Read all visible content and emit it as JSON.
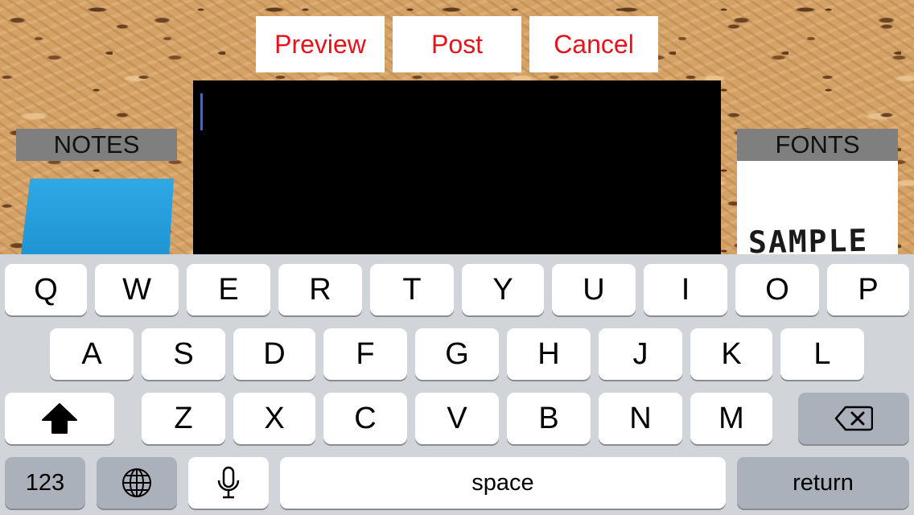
{
  "toolbar": {
    "preview_label": "Preview",
    "post_label": "Post",
    "cancel_label": "Cancel",
    "accent_color": "#e8121a"
  },
  "notes_panel": {
    "label": "NOTES",
    "note_color": "#2fa8e4"
  },
  "fonts_panel": {
    "label": "FONTS",
    "sample_text": "SAMPLE"
  },
  "editor": {
    "value": ""
  },
  "keyboard": {
    "row1": [
      "Q",
      "W",
      "E",
      "R",
      "T",
      "Y",
      "U",
      "I",
      "O",
      "P"
    ],
    "row2": [
      "A",
      "S",
      "D",
      "F",
      "G",
      "H",
      "J",
      "K",
      "L"
    ],
    "row3": [
      "Z",
      "X",
      "C",
      "V",
      "B",
      "N",
      "M"
    ],
    "numbers_label": "123",
    "space_label": "space",
    "return_label": "return",
    "shift_icon": "shift-icon",
    "delete_icon": "delete-icon",
    "globe_icon": "globe-icon",
    "mic_icon": "microphone-icon"
  }
}
